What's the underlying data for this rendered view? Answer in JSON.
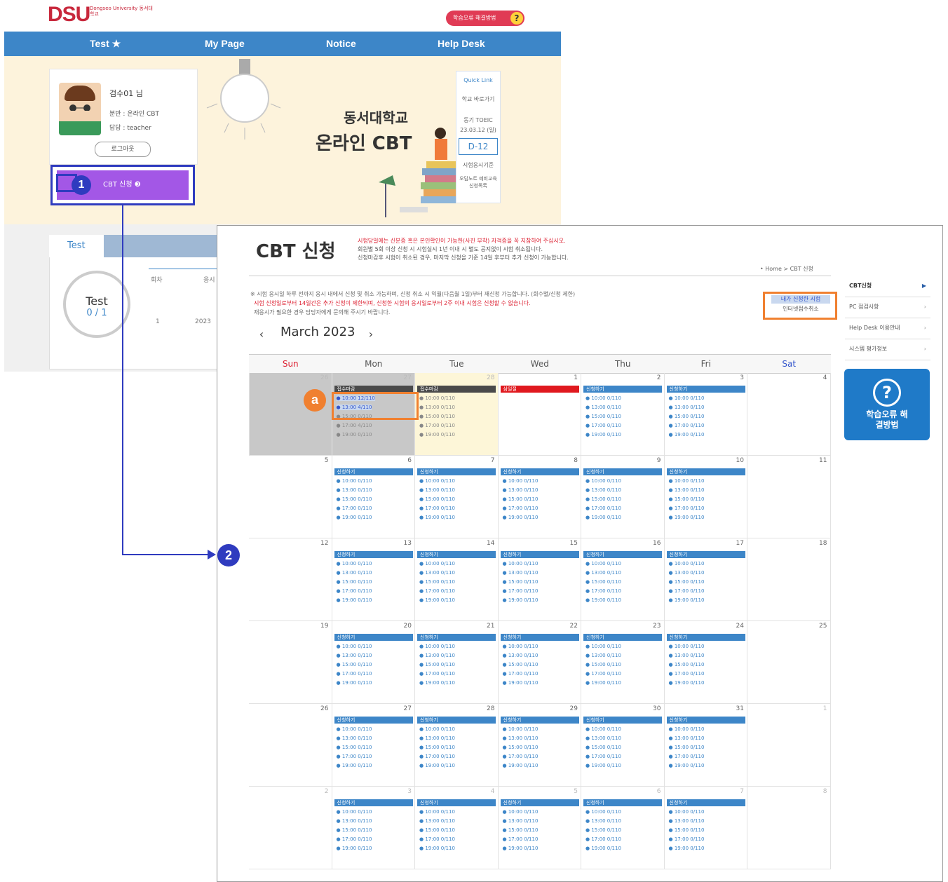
{
  "background_page": {
    "logo": "DSU",
    "logo_sub": "Dongseo University 동서대학교",
    "help_pill": "학습오류 해결방법",
    "nav": [
      "Test ★",
      "My Page",
      "Notice",
      "Help Desk"
    ],
    "profile": {
      "name": "검수01 님",
      "line1": "분반 : 온라인 CBT",
      "line2": "담당 : teacher",
      "logout": "로그아웃"
    },
    "cbt_button": "CBT 신청 ❸",
    "hero_title1": "동서대학교",
    "hero_title2": "온라인 CBT",
    "quick_link": {
      "title": "Quick Link",
      "items": [
        "학교 바로가기",
        "동기 TOEIC",
        "23.03.12 (일)",
        "시험응시기준",
        "오답노트 예비교육 신청목록"
      ],
      "dday": "D-12"
    },
    "lower_tab": "Test",
    "test_circle": {
      "label": "Test",
      "value": "0 / 1"
    },
    "lower_table": {
      "col1": "회차",
      "col2": "응시",
      "row1": "1",
      "row2": "2023"
    }
  },
  "markers": {
    "m1": "1",
    "m2": "2",
    "ma": "a"
  },
  "panel": {
    "title": "CBT 신청",
    "notice_lines": [
      "시험당일에는 신분증 혹은 본인확인이 가능한(사진 부착) 자격증을 꼭 지참하여 주십시오.",
      "회원별 5회 이상 신청 시 시험실시 1년 이내 시 별도 공지없이 시험 취소됩니다.",
      "신청마감후 시험이 취소된 경우, 마지막 신청을 기준 14일 후부터 추가 신청이 가능합니다."
    ],
    "breadcrumb": "• Home > CBT 신청",
    "info_lines": [
      "※ 시험 응시일 하루 전까지 응시 내에서 신청 및 취소 가능하며, 신청 취소 시 익월(다음월 1일)부터 재신청 가능합니다. (회수별/신청 제한)",
      "시험 신청일로부터 14일간은 추가 신청이 제한되며, 신청한 시험의 응시일로부터 2주 이내 시험은 신청할 수 없습니다.",
      "재응시가 필요한 경우 담당자에게 문의해 주시기 바랍니다."
    ],
    "orange_buttons": [
      "내가 신청한 시험",
      "인터넷접수취소"
    ],
    "month": "March 2023",
    "prev": "‹",
    "next": "›",
    "dow": [
      "Sun",
      "Mon",
      "Tue",
      "Wed",
      "Thu",
      "Fri",
      "Sat"
    ],
    "weeks": [
      [
        "26",
        "27",
        "28",
        "1",
        "2",
        "3",
        "4"
      ],
      [
        "5",
        "6",
        "7",
        "8",
        "9",
        "10",
        "11"
      ],
      [
        "12",
        "13",
        "14",
        "15",
        "16",
        "17",
        "18"
      ],
      [
        "19",
        "20",
        "21",
        "22",
        "23",
        "24",
        "25"
      ],
      [
        "26",
        "27",
        "28",
        "29",
        "30",
        "31",
        "1"
      ],
      [
        "2",
        "3",
        "4",
        "5",
        "6",
        "7",
        "8"
      ]
    ],
    "bars": {
      "closed": "접수마감",
      "holiday": "삼일절",
      "open": "신청하기"
    },
    "slots": [
      "10:00 0/110",
      "13:00 0/110",
      "15:00 0/110",
      "17:00 0/110",
      "19:00 0/110"
    ],
    "week1_mon_slots": [
      "10:00 12/110",
      "13:00 4/110",
      "15:00 0/110",
      "17:00 4/110",
      "19:00 0/110"
    ],
    "side_menu": [
      "CBT신청",
      "PC 점검사항",
      "Help Desk 이용안내",
      "시스템 평가정보"
    ],
    "side_help": "학습오류 해결방법"
  },
  "colors": {
    "nav": "#3d86c8",
    "accent_purple": "#a357e6",
    "marker": "#2f3bbf",
    "highlight": "#f08030",
    "holiday": "#e0191f",
    "closed": "#4a4a4a",
    "open": "#3d86c8"
  }
}
